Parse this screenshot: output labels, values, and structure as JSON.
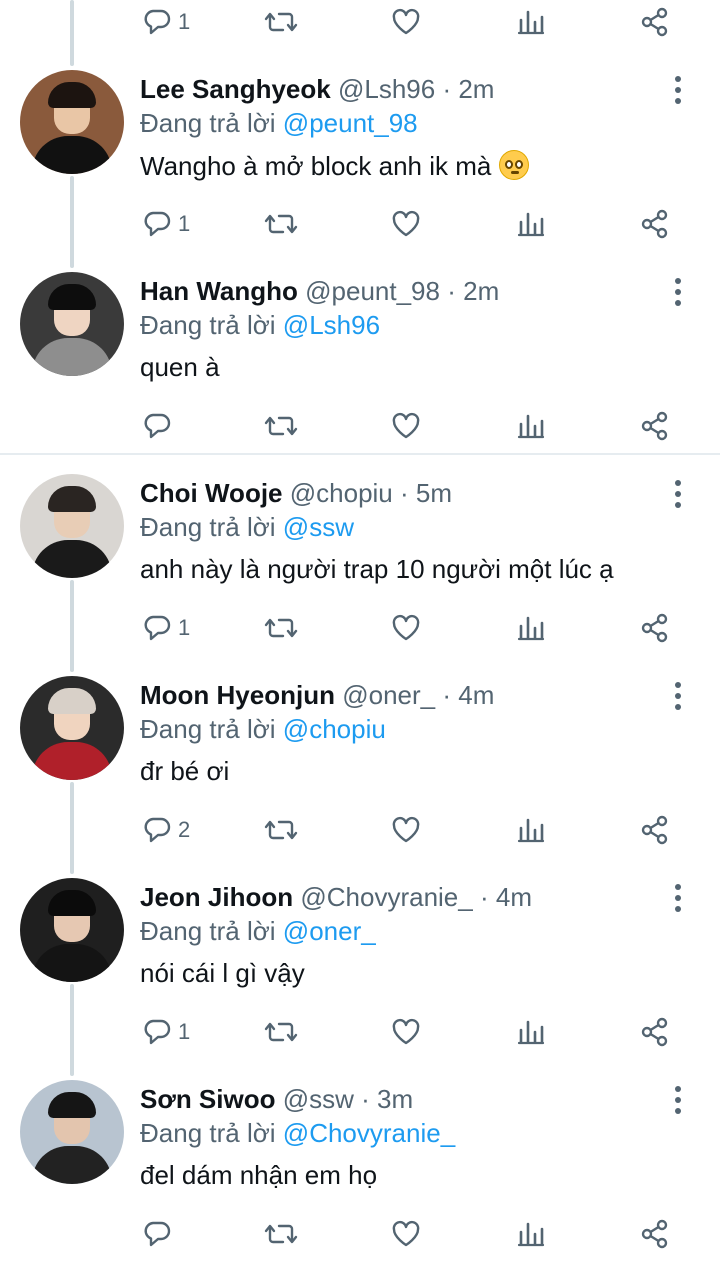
{
  "top_actions": {
    "reply_count": "1"
  },
  "tweets": [
    {
      "name": "Lee Sanghyeok",
      "handle": "@Lsh96",
      "time": "2m",
      "replying_prefix": "Đang trả lời",
      "replying_to": "@peunt_98",
      "text": "Wangho à mở block anh ik mà",
      "emoji": "pleading-face-emoji",
      "reply_count": "1",
      "avatar_colors": {
        "bg": "#8a5a3c",
        "hair": "#1c1410",
        "face": "#e9c6a6",
        "body": "#111111"
      }
    },
    {
      "name": "Han Wangho",
      "handle": "@peunt_98",
      "time": "2m",
      "replying_prefix": "Đang trả lời",
      "replying_to": "@Lsh96",
      "text": "quen à",
      "reply_count": "",
      "avatar_colors": {
        "bg": "#3a3a3a",
        "hair": "#0d0d0d",
        "face": "#efd5c2",
        "body": "#8e8e8e"
      }
    },
    {
      "name": "Choi Wooje",
      "handle": "@chopiu",
      "time": "5m",
      "replying_prefix": "Đang trả lời",
      "replying_to": "@ssw",
      "text": "anh này là người trap 10 người một lúc ạ",
      "reply_count": "1",
      "avatar_colors": {
        "bg": "#d9d6d2",
        "hair": "#2a2522",
        "face": "#e8cdb6",
        "body": "#1a1a1a"
      }
    },
    {
      "name": "Moon Hyeonjun",
      "handle": "@oner_",
      "time": "4m",
      "replying_prefix": "Đang trả lời",
      "replying_to": "@chopiu",
      "text": "đr bé ơi",
      "reply_count": "2",
      "avatar_colors": {
        "bg": "#2b2b2b",
        "hair": "#d8d0c8",
        "face": "#f0d4bf",
        "body": "#b0202a"
      }
    },
    {
      "name": "Jeon Jihoon",
      "handle": "@Chovyranie_",
      "time": "4m",
      "replying_prefix": "Đang trả lời",
      "replying_to": "@oner_",
      "text": "nói cái l gì vậy",
      "reply_count": "1",
      "avatar_colors": {
        "bg": "#1f1f1f",
        "hair": "#0b0b0b",
        "face": "#e6c8b2",
        "body": "#141414"
      }
    },
    {
      "name": "Sơn Siwoo",
      "handle": "@ssw",
      "time": "3m",
      "replying_prefix": "Đang trả lời",
      "replying_to": "@Chovyranie_",
      "text": "đel dám nhận em họ",
      "reply_count": "",
      "avatar_colors": {
        "bg": "#b8c4d0",
        "hair": "#151515",
        "face": "#e3c5ae",
        "body": "#222222"
      }
    }
  ],
  "colors": {
    "accent": "#1d9bf0",
    "secondary_text": "#536471",
    "primary_text": "#0f1419",
    "thread_line": "#cfd9de"
  }
}
